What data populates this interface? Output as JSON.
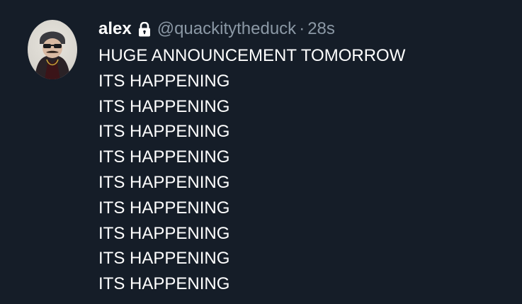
{
  "tweet": {
    "author": {
      "display_name": "alex",
      "handle": "@quackitytheduck",
      "protected_icon": "lock-icon"
    },
    "separator": "·",
    "timestamp": "28s",
    "lines": [
      "HUGE ANNOUNCEMENT TOMORROW",
      "ITS HAPPENING",
      "ITS HAPPENING",
      "ITS HAPPENING",
      "ITS HAPPENING",
      "ITS HAPPENING",
      "ITS HAPPENING",
      "ITS HAPPENING",
      "ITS HAPPENING",
      "ITS HAPPENING"
    ]
  },
  "colors": {
    "background": "#151d28",
    "text_primary": "#ffffff",
    "text_secondary": "#8b98a5"
  }
}
